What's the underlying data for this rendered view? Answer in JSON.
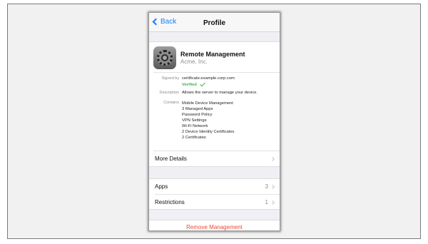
{
  "nav": {
    "back_label": "Back",
    "title": "Profile"
  },
  "profile": {
    "icon": "settings-gear-icon",
    "name": "Remote Management",
    "organization": "Acme, Inc.",
    "signed_by_label": "Signed by",
    "signed_by_value": "certificate.example.corp.com",
    "verified_label": "Verified",
    "description_label": "Description",
    "description_value": "Allows the server to manage your device.",
    "contains_label": "Contains",
    "contains_items": [
      "Mobile Device Management",
      "3 Managed Apps",
      "Password Policy",
      "VPN Settings",
      "Wi-Fi Network",
      "2 Device Identity Certificates",
      "2 Certificates"
    ],
    "more_details_label": "More Details"
  },
  "list": {
    "apps_label": "Apps",
    "apps_count": "3",
    "restrictions_label": "Restrictions",
    "restrictions_count": "1"
  },
  "actions": {
    "remove_label": "Remove Management",
    "remove_color": "#f0453a"
  },
  "colors": {
    "accent": "#1a7cf7",
    "verified": "#3bb54a"
  }
}
